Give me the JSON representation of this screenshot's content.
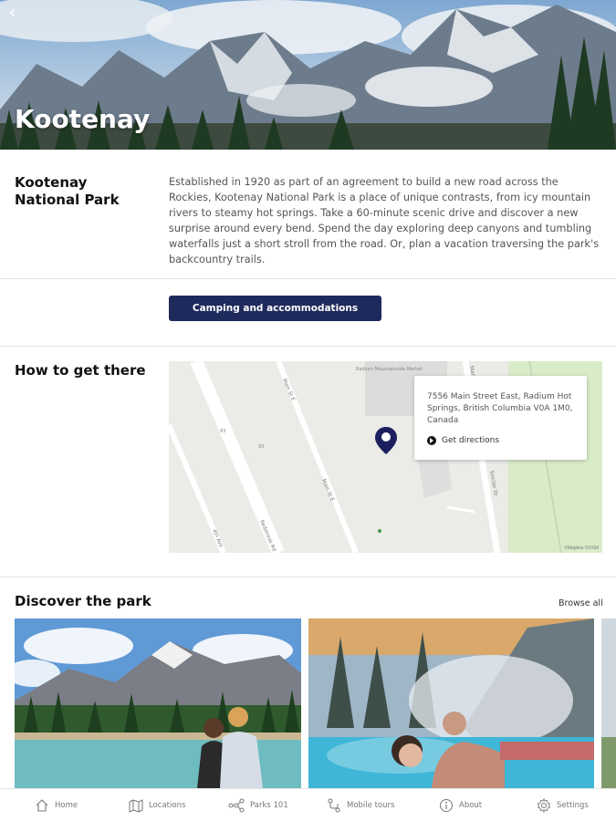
{
  "hero": {
    "title": "Kootenay",
    "back_icon": "chevron-left-icon"
  },
  "about": {
    "heading": "Kootenay National Park",
    "text": "Established in 1920 as part of an agreement to build a new road across the Rockies, Kootenay National Park is a place of unique contrasts, from icy mountain rivers to steamy hot springs. Take a 60-minute scenic drive and discover a new surprise around every bend. Spend the day exploring deep canyons and tumbling waterfalls just a short stroll from the road. Or, plan a vacation traversing the park's backcountry trails."
  },
  "camping_button": {
    "label": "Camping and accommodations"
  },
  "directions": {
    "heading": "How to get there",
    "address": "7556 Main Street East, Radium Hot Springs, British Columbia V0A 1M0, Canada",
    "get_directions_label": "Get directions",
    "map_labels": {
      "market": "Radium Mountainside Market",
      "route": "93",
      "main_st": "Main St E",
      "main_st_2": "Main St E",
      "street_a": "Redstreak Rd",
      "street_b": "Stanley St",
      "street_c": "Sinclair Dr",
      "avenue": "4th Ave",
      "copyright": "©Mapbox ©OSM"
    }
  },
  "discover": {
    "heading": "Discover the park",
    "browse_all_label": "Browse all"
  },
  "bottom_nav": [
    {
      "label": "Home",
      "icon": "home-icon"
    },
    {
      "label": "Locations",
      "icon": "map-icon"
    },
    {
      "label": "Parks 101",
      "icon": "network-icon"
    },
    {
      "label": "Mobile tours",
      "icon": "route-icon"
    },
    {
      "label": "About",
      "icon": "info-icon"
    },
    {
      "label": "Settings",
      "icon": "gear-icon"
    }
  ],
  "colors": {
    "accent": "#1f2a5c",
    "map_pin": "#1c1f5e"
  }
}
